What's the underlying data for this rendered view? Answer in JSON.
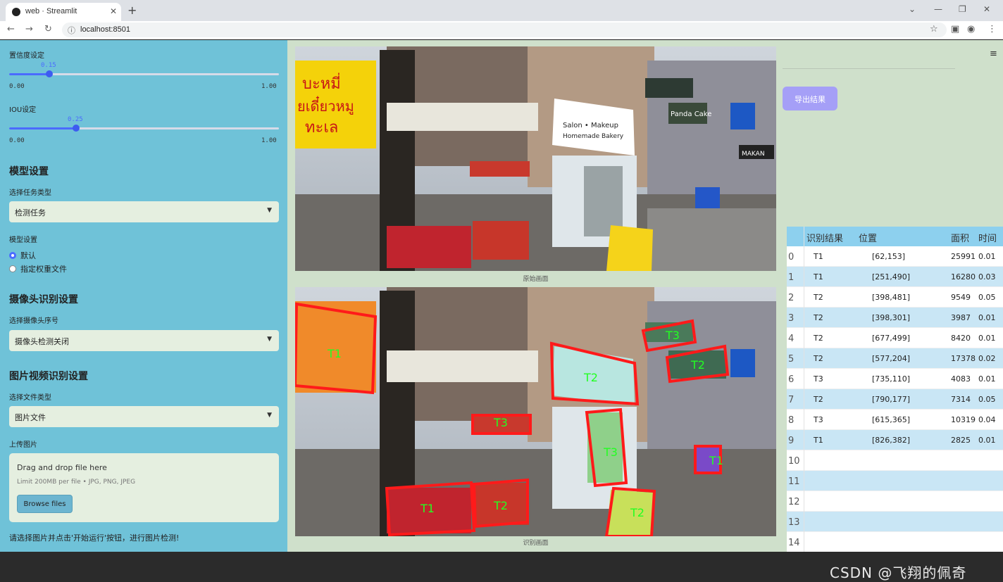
{
  "browser": {
    "tab_title": "web · Streamlit",
    "url": "localhost:8501"
  },
  "sidebar": {
    "conf_label": "置信度设定",
    "conf_value": "0.15",
    "conf_min": "0.00",
    "conf_max": "1.00",
    "conf_fraction": 0.15,
    "iou_label": "IOU设定",
    "iou_value": "0.25",
    "iou_min": "0.00",
    "iou_max": "1.00",
    "iou_fraction": 0.25,
    "model_header": "模型设置",
    "task_label": "选择任务类型",
    "task_value": "检测任务",
    "model_label": "模型设置",
    "radio_default": "默认",
    "radio_custom": "指定权重文件",
    "camera_header": "摄像头识别设置",
    "camera_label": "选择摄像头序号",
    "camera_value": "摄像头检测关闭",
    "media_header": "图片视频识别设置",
    "filetype_label": "选择文件类型",
    "filetype_value": "图片文件",
    "upload_label": "上传图片",
    "upload_drag": "Drag and drop file here",
    "upload_limit": "Limit 200MB per file • JPG, PNG, JPEG",
    "upload_button": "Browse files",
    "footer_hint": "请选择图片并点击'开始运行'按钮，进行图片检测!"
  },
  "main": {
    "caption_original": "原始画面",
    "caption_result": "识别画面",
    "export_button": "导出结果",
    "sign_thai_1": "บะหมี่",
    "sign_thai_2": "ยเดี๋ยวหมู",
    "sign_thai_3": "ทะเล",
    "sign_salon": "Salon • Makeup",
    "sign_bakery": "Homemade Bakery",
    "sign_panda": "Panda Cake",
    "sign_makan": "MAKAN",
    "labels": [
      "T1",
      "T2",
      "T3",
      "T2",
      "T3",
      "T3",
      "T1",
      "T1",
      "T2",
      "T2"
    ]
  },
  "table": {
    "headers": [
      "识别结果",
      "位置",
      "面积",
      "时间"
    ],
    "rows": [
      {
        "i": "0",
        "cls": "T1",
        "pos": "[62,153]",
        "area": "25991",
        "time": "0.01"
      },
      {
        "i": "1",
        "cls": "T1",
        "pos": "[251,490]",
        "area": "16280",
        "time": "0.03"
      },
      {
        "i": "2",
        "cls": "T2",
        "pos": "[398,481]",
        "area": "9549",
        "time": "0.05"
      },
      {
        "i": "3",
        "cls": "T2",
        "pos": "[398,301]",
        "area": "3987",
        "time": "0.01"
      },
      {
        "i": "4",
        "cls": "T2",
        "pos": "[677,499]",
        "area": "8420",
        "time": "0.01"
      },
      {
        "i": "5",
        "cls": "T2",
        "pos": "[577,204]",
        "area": "17378",
        "time": "0.02"
      },
      {
        "i": "6",
        "cls": "T3",
        "pos": "[735,110]",
        "area": "4083",
        "time": "0.01"
      },
      {
        "i": "7",
        "cls": "T2",
        "pos": "[790,177]",
        "area": "7314",
        "time": "0.05"
      },
      {
        "i": "8",
        "cls": "T3",
        "pos": "[615,365]",
        "area": "10319",
        "time": "0.04"
      },
      {
        "i": "9",
        "cls": "T1",
        "pos": "[826,382]",
        "area": "2825",
        "time": "0.01"
      },
      {
        "i": "10",
        "cls": "",
        "pos": "",
        "area": "",
        "time": ""
      },
      {
        "i": "11",
        "cls": "",
        "pos": "",
        "area": "",
        "time": ""
      },
      {
        "i": "12",
        "cls": "",
        "pos": "",
        "area": "",
        "time": ""
      },
      {
        "i": "13",
        "cls": "",
        "pos": "",
        "area": "",
        "time": ""
      },
      {
        "i": "14",
        "cls": "",
        "pos": "",
        "area": "",
        "time": ""
      }
    ]
  },
  "watermark": "CSDN @飞翔的佩奇",
  "colors": {
    "sidebar": "#6fc2d8",
    "main_bg": "#cfe0cb",
    "slider": "#4b6bff",
    "export": "#a59ff7",
    "table_head": "#8dd0ee",
    "box": "#ff1a1a",
    "box_label": "#22ff22"
  }
}
